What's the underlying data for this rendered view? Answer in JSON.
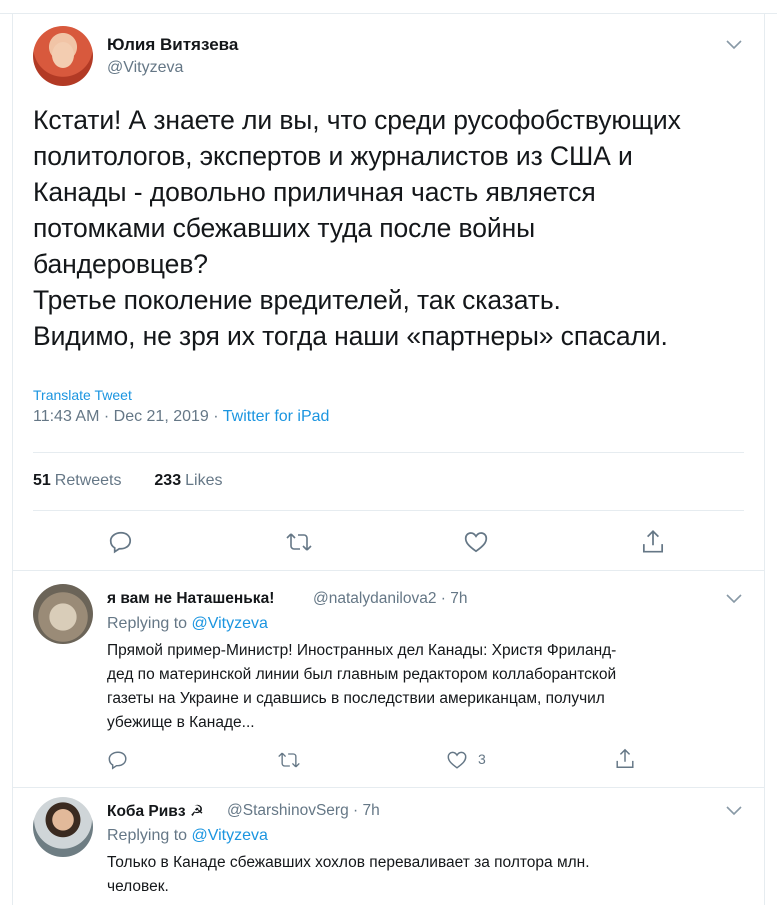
{
  "main_tweet": {
    "author_name": "Юлия Витязева",
    "author_handle": "@Vityzeva",
    "text": "Кстати! А знаете ли вы, что среди русофобствующих\nполитологов, экспертов и журналистов из США и\nКанады - довольно приличная часть является\nпотомками сбежавших туда после войны\nбандеровцев?\nТретье поколение вредителей, так сказать.\nВидимо, не зря их тогда наши «партнеры» спасали.",
    "translate_label": "Translate Tweet",
    "time": "11:43 AM · Dec 21, 2019 · ",
    "source": "Twitter for iPad",
    "retweets_count": "51",
    "retweets_label": "Retweets",
    "likes_count": "233",
    "likes_label": "Likes"
  },
  "replies": [
    {
      "author_name": "я вам не Наташенька!",
      "author_handle": "@natalydanilova2 · 7h",
      "replying_prefix": "Replying to ",
      "replying_handle": "@Vityzeva",
      "text": "Прямой пример-Министр! Иностранных дел Канады: Христя Фриланд-\nдед по материнской линии был главным редактором коллаборантской\nгазеты на Украине и сдавшись в последствии американцам, получил\nубежище в Канаде...",
      "like_count": "3"
    },
    {
      "author_name": "Коба Ривз ☭",
      "author_handle": "@StarshinovSerg · 7h",
      "replying_prefix": "Replying to ",
      "replying_handle": "@Vityzeva",
      "text": "Только в Канаде сбежавших хохлов переваливает за полтора млн.\nчеловек."
    }
  ],
  "colors": {
    "accent": "#1b95e0",
    "secondary_text": "#657786",
    "border": "#e6ecf0",
    "icon": "#657786"
  },
  "icons": [
    "chevron-down-icon",
    "reply-icon",
    "retweet-icon",
    "like-icon",
    "share-icon"
  ]
}
